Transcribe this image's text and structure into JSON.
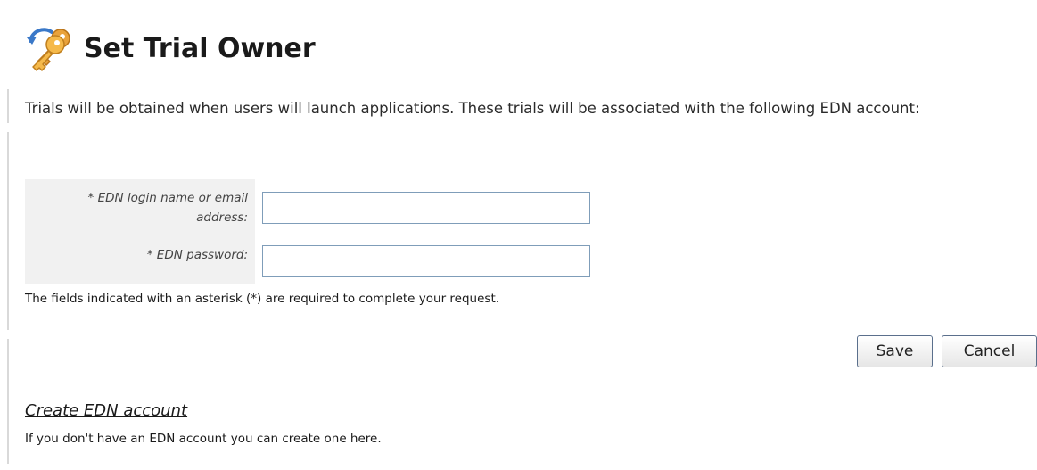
{
  "header": {
    "title": "Set Trial Owner",
    "icon": "keys-icon"
  },
  "intro": {
    "text": "Trials will be obtained when users will launch applications. These trials will be associated with the following EDN account:"
  },
  "form": {
    "login_label": "* EDN login name or email address:",
    "login_value": "",
    "password_label": "* EDN password:",
    "password_value": "",
    "required_note": "The fields indicated with an asterisk (*) are required to complete your request."
  },
  "actions": {
    "save_label": "Save",
    "cancel_label": "Cancel"
  },
  "create_account": {
    "link_label": "Create EDN account",
    "hint": "If you don't have an EDN account you can create one here."
  },
  "colors": {
    "icon_orange": "#f0a020",
    "icon_blue": "#3a78c8",
    "input_border": "#7f9db9",
    "label_panel": "#f1f1f1"
  }
}
